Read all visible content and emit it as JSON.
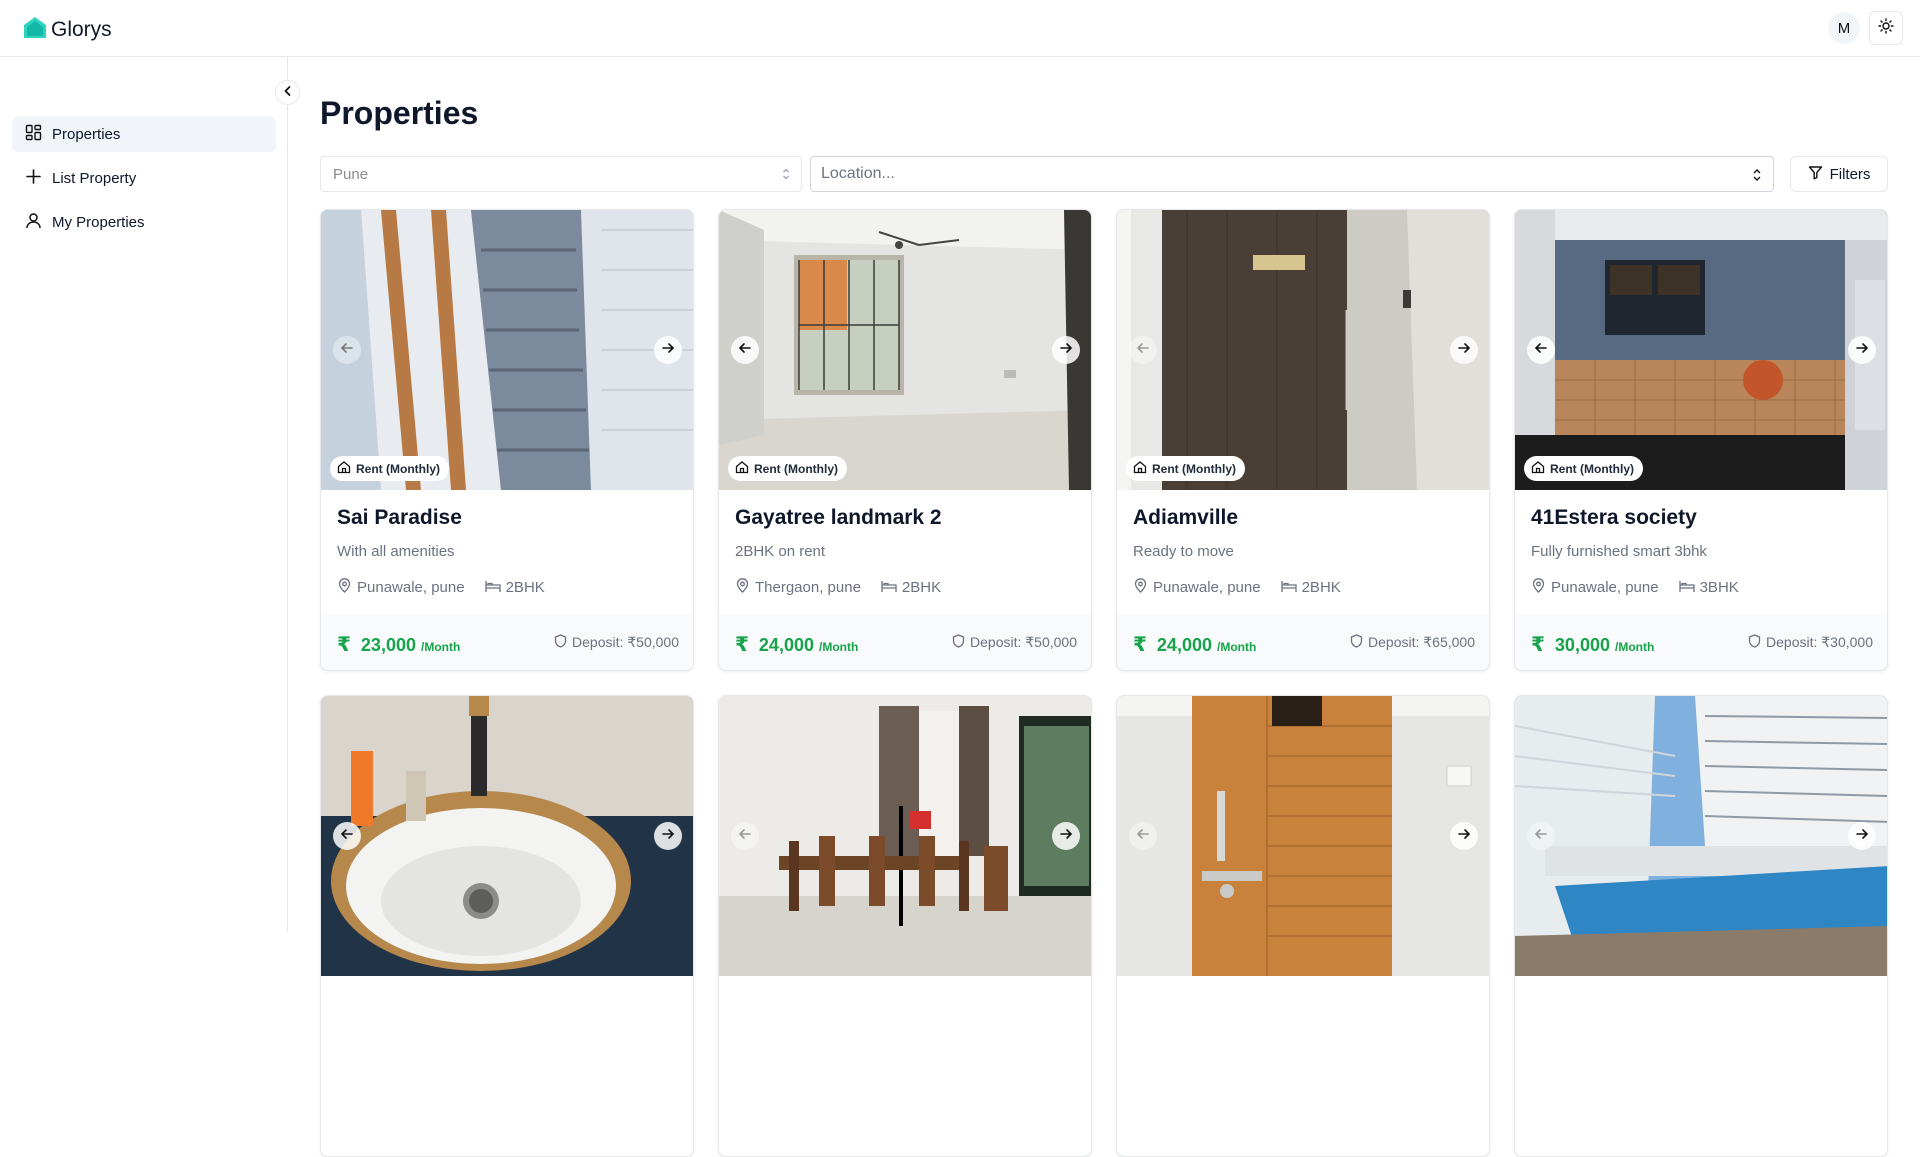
{
  "brand": {
    "name": "Glorys",
    "color": "#2dd4bf"
  },
  "header": {
    "avatar_initial": "M"
  },
  "sidebar": {
    "items": [
      {
        "label": "Properties",
        "icon": "grid-icon",
        "active": true
      },
      {
        "label": "List Property",
        "icon": "plus-icon"
      },
      {
        "label": "My Properties",
        "icon": "user-icon"
      }
    ]
  },
  "main": {
    "title": "Properties",
    "city_select": "Pune",
    "location_placeholder": "Location...",
    "filters_label": "Filters"
  },
  "cards": [
    {
      "title": "Sai Paradise",
      "subtitle": "With all amenities",
      "location": "Punawale, pune",
      "bhk": "2BHK",
      "badge": "Rent (Monthly)",
      "price": "23,000",
      "per": "/Month",
      "deposit": "Deposit: ₹50,000"
    },
    {
      "title": "Gayatree landmark 2",
      "subtitle": "2BHK on rent",
      "location": "Thergaon, pune",
      "bhk": "2BHK",
      "badge": "Rent (Monthly)",
      "price": "24,000",
      "per": "/Month",
      "deposit": "Deposit: ₹50,000"
    },
    {
      "title": "Adiamville",
      "subtitle": "Ready to move",
      "location": "Punawale, pune",
      "bhk": "2BHK",
      "badge": "Rent (Monthly)",
      "price": "24,000",
      "per": "/Month",
      "deposit": "Deposit: ₹65,000"
    },
    {
      "title": "41Estera society",
      "subtitle": "Fully furnished smart 3bhk",
      "location": "Punawale, pune",
      "bhk": "3BHK",
      "badge": "Rent (Monthly)",
      "price": "30,000",
      "per": "/Month",
      "deposit": "Deposit: ₹30,000"
    }
  ],
  "currency_symbol": "₹",
  "colors": {
    "price": "#16a34a",
    "active_nav": "#f1f5f9"
  }
}
